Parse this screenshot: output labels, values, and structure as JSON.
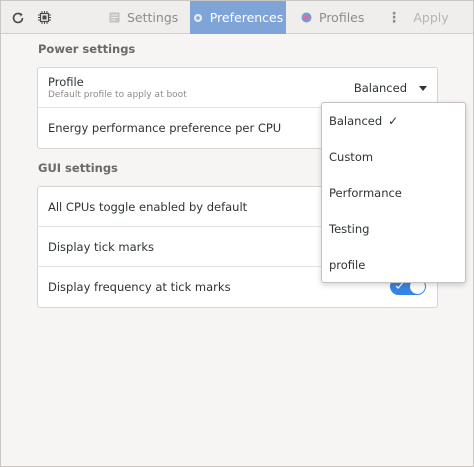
{
  "header": {
    "tabs": [
      {
        "label": "Settings",
        "icon": "settings-icon"
      },
      {
        "label": "Preferences",
        "icon": "preferences-icon",
        "active": true
      },
      {
        "label": "Profiles",
        "icon": "profiles-icon"
      }
    ],
    "menu_glyph": "⋮",
    "apply_label": "Apply",
    "active_color": "#7fa5d8"
  },
  "power": {
    "title": "Power settings",
    "profile_title": "Profile",
    "profile_subtitle": "Default profile to apply at boot",
    "profile_value": "Balanced",
    "epp_label": "Energy performance preference per CPU"
  },
  "gui": {
    "title": "GUI settings",
    "rows": [
      "All CPUs toggle enabled by default",
      "Display tick marks",
      "Display frequency at tick marks"
    ],
    "toggle_on": true,
    "toggle_color": "#3584e4"
  },
  "popover": {
    "items": [
      "Balanced",
      "Custom",
      "Performance",
      "Testing",
      "profile"
    ],
    "selected": "Balanced",
    "check_glyph": "✓"
  }
}
